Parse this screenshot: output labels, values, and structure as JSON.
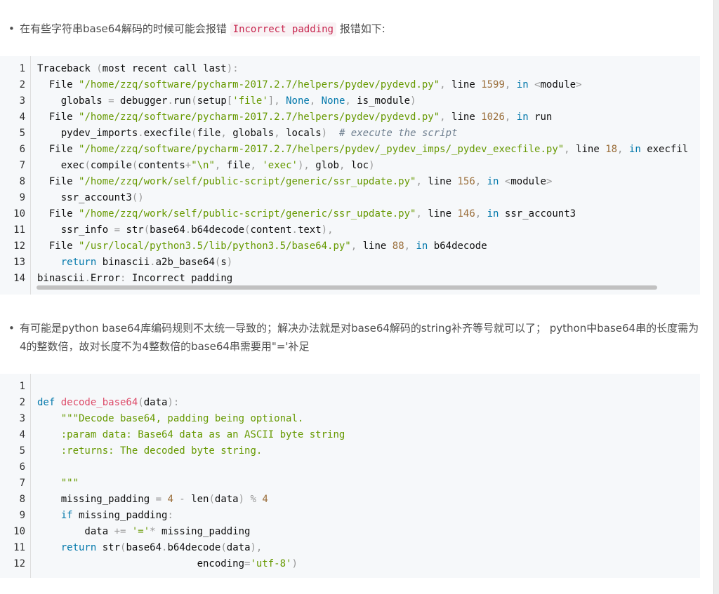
{
  "bullet1": {
    "marker": "•",
    "before": "在有些字符串base64解码的时候可能会报错",
    "code": "Incorrect padding",
    "after": "报错如下:"
  },
  "traceback_lines": [
    [
      [
        "nm",
        "Traceback "
      ],
      [
        "p",
        "("
      ],
      [
        "nm",
        "most recent call last"
      ],
      [
        "p",
        ")"
      ],
      [
        "p",
        ":"
      ]
    ],
    [
      [
        "nm",
        "  File "
      ],
      [
        "str",
        "\"/home/zzq/software/pycharm-2017.2.7/helpers/pydev/pydevd.py\""
      ],
      [
        "p",
        ", "
      ],
      [
        "nm",
        "line "
      ],
      [
        "num",
        "1599"
      ],
      [
        "p",
        ", "
      ],
      [
        "kw2",
        "in "
      ],
      [
        "p",
        "<"
      ],
      [
        "nm",
        "module"
      ],
      [
        "p",
        ">"
      ]
    ],
    [
      [
        "nm",
        "    globals "
      ],
      [
        "p",
        "= "
      ],
      [
        "nm",
        "debugger"
      ],
      [
        "p",
        "."
      ],
      [
        "nm",
        "run"
      ],
      [
        "p",
        "("
      ],
      [
        "nm",
        "setup"
      ],
      [
        "p",
        "["
      ],
      [
        "str",
        "'file'"
      ],
      [
        "p",
        "], "
      ],
      [
        "kw2",
        "None"
      ],
      [
        "p",
        ", "
      ],
      [
        "kw2",
        "None"
      ],
      [
        "p",
        ", "
      ],
      [
        "nm",
        "is_module"
      ],
      [
        "p",
        ")"
      ]
    ],
    [
      [
        "nm",
        "  File "
      ],
      [
        "str",
        "\"/home/zzq/software/pycharm-2017.2.7/helpers/pydev/pydevd.py\""
      ],
      [
        "p",
        ", "
      ],
      [
        "nm",
        "line "
      ],
      [
        "num",
        "1026"
      ],
      [
        "p",
        ", "
      ],
      [
        "kw2",
        "in "
      ],
      [
        "nm",
        "run"
      ]
    ],
    [
      [
        "nm",
        "    pydev_imports"
      ],
      [
        "p",
        "."
      ],
      [
        "nm",
        "execfile"
      ],
      [
        "p",
        "("
      ],
      [
        "nm",
        "file"
      ],
      [
        "p",
        ", "
      ],
      [
        "nm",
        "globals"
      ],
      [
        "p",
        ", "
      ],
      [
        "nm",
        "locals"
      ],
      [
        "p",
        ")  "
      ],
      [
        "com",
        "# execute the script"
      ]
    ],
    [
      [
        "nm",
        "  File "
      ],
      [
        "str",
        "\"/home/zzq/software/pycharm-2017.2.7/helpers/pydev/_pydev_imps/_pydev_execfile.py\""
      ],
      [
        "p",
        ", "
      ],
      [
        "nm",
        "line "
      ],
      [
        "num",
        "18"
      ],
      [
        "p",
        ", "
      ],
      [
        "kw2",
        "in "
      ],
      [
        "nm",
        "execfile"
      ]
    ],
    [
      [
        "nm",
        "    exec"
      ],
      [
        "p",
        "("
      ],
      [
        "nm",
        "compile"
      ],
      [
        "p",
        "("
      ],
      [
        "nm",
        "contents"
      ],
      [
        "p",
        "+"
      ],
      [
        "str",
        "\"\\n\""
      ],
      [
        "p",
        ", "
      ],
      [
        "nm",
        "file"
      ],
      [
        "p",
        ", "
      ],
      [
        "str",
        "'exec'"
      ],
      [
        "p",
        "), "
      ],
      [
        "nm",
        "glob"
      ],
      [
        "p",
        ", "
      ],
      [
        "nm",
        "loc"
      ],
      [
        "p",
        ")"
      ]
    ],
    [
      [
        "nm",
        "  File "
      ],
      [
        "str",
        "\"/home/zzq/work/self/public-script/generic/ssr_update.py\""
      ],
      [
        "p",
        ", "
      ],
      [
        "nm",
        "line "
      ],
      [
        "num",
        "156"
      ],
      [
        "p",
        ", "
      ],
      [
        "kw2",
        "in "
      ],
      [
        "p",
        "<"
      ],
      [
        "nm",
        "module"
      ],
      [
        "p",
        ">"
      ]
    ],
    [
      [
        "nm",
        "    ssr_account3"
      ],
      [
        "p",
        "()"
      ]
    ],
    [
      [
        "nm",
        "  File "
      ],
      [
        "str",
        "\"/home/zzq/work/self/public-script/generic/ssr_update.py\""
      ],
      [
        "p",
        ", "
      ],
      [
        "nm",
        "line "
      ],
      [
        "num",
        "146"
      ],
      [
        "p",
        ", "
      ],
      [
        "kw2",
        "in "
      ],
      [
        "nm",
        "ssr_account3"
      ]
    ],
    [
      [
        "nm",
        "    ssr_info "
      ],
      [
        "p",
        "= "
      ],
      [
        "nm",
        "str"
      ],
      [
        "p",
        "("
      ],
      [
        "nm",
        "base64"
      ],
      [
        "p",
        "."
      ],
      [
        "nm",
        "b64decode"
      ],
      [
        "p",
        "("
      ],
      [
        "nm",
        "content"
      ],
      [
        "p",
        "."
      ],
      [
        "nm",
        "text"
      ],
      [
        "p",
        "),"
      ]
    ],
    [
      [
        "nm",
        "  File "
      ],
      [
        "str",
        "\"/usr/local/python3.5/lib/python3.5/base64.py\""
      ],
      [
        "p",
        ", "
      ],
      [
        "nm",
        "line "
      ],
      [
        "num",
        "88"
      ],
      [
        "p",
        ", "
      ],
      [
        "kw2",
        "in "
      ],
      [
        "nm",
        "b64decode"
      ]
    ],
    [
      [
        "nm",
        "    "
      ],
      [
        "kw2",
        "return "
      ],
      [
        "nm",
        "binascii"
      ],
      [
        "p",
        "."
      ],
      [
        "nm",
        "a2b_base64"
      ],
      [
        "p",
        "("
      ],
      [
        "nm",
        "s"
      ],
      [
        "p",
        ")"
      ]
    ],
    [
      [
        "nm",
        "binascii"
      ],
      [
        "p",
        "."
      ],
      [
        "nm",
        "Error"
      ],
      [
        "p",
        ": "
      ],
      [
        "nm",
        "Incorrect padding"
      ]
    ]
  ],
  "bullet2": {
    "marker": "•",
    "text": "有可能是python base64库编码规则不太统一导致的；解决办法就是对base64解码的string补齐等号就可以了；     python中base64串的长度需为4的整数倍，故对长度不为4整数倍的base64串需要用\"='补足"
  },
  "func_lines": [
    [],
    [
      [
        "kw2",
        "def "
      ],
      [
        "fn",
        "decode_base64"
      ],
      [
        "p",
        "("
      ],
      [
        "nm",
        "data"
      ],
      [
        "p",
        "):"
      ]
    ],
    [
      [
        "nm",
        "    "
      ],
      [
        "str",
        "\"\"\"Decode base64, padding being optional."
      ]
    ],
    [
      [
        "nm",
        "    "
      ],
      [
        "str",
        ":param data: Base64 data as an ASCII byte string"
      ]
    ],
    [
      [
        "nm",
        "    "
      ],
      [
        "str",
        ":returns: The decoded byte string."
      ]
    ],
    [],
    [
      [
        "nm",
        "    "
      ],
      [
        "str",
        "\"\"\""
      ]
    ],
    [
      [
        "nm",
        "    missing_padding "
      ],
      [
        "p",
        "= "
      ],
      [
        "num",
        "4 "
      ],
      [
        "p",
        "- "
      ],
      [
        "nm",
        "len"
      ],
      [
        "p",
        "("
      ],
      [
        "nm",
        "data"
      ],
      [
        "p",
        ") "
      ],
      [
        "p",
        "% "
      ],
      [
        "num",
        "4"
      ]
    ],
    [
      [
        "nm",
        "    "
      ],
      [
        "kw2",
        "if "
      ],
      [
        "nm",
        "missing_padding"
      ],
      [
        "p",
        ":"
      ]
    ],
    [
      [
        "nm",
        "        data "
      ],
      [
        "p",
        "+= "
      ],
      [
        "str",
        "'='"
      ],
      [
        "p",
        "* "
      ],
      [
        "nm",
        "missing_padding"
      ]
    ],
    [
      [
        "nm",
        "    "
      ],
      [
        "kw2",
        "return "
      ],
      [
        "nm",
        "str"
      ],
      [
        "p",
        "("
      ],
      [
        "nm",
        "base64"
      ],
      [
        "p",
        "."
      ],
      [
        "nm",
        "b64decode"
      ],
      [
        "p",
        "("
      ],
      [
        "nm",
        "data"
      ],
      [
        "p",
        "),"
      ]
    ],
    [
      [
        "nm",
        "                           encoding"
      ],
      [
        "p",
        "="
      ],
      [
        "str",
        "'utf-8'"
      ],
      [
        "p",
        ")"
      ]
    ]
  ]
}
